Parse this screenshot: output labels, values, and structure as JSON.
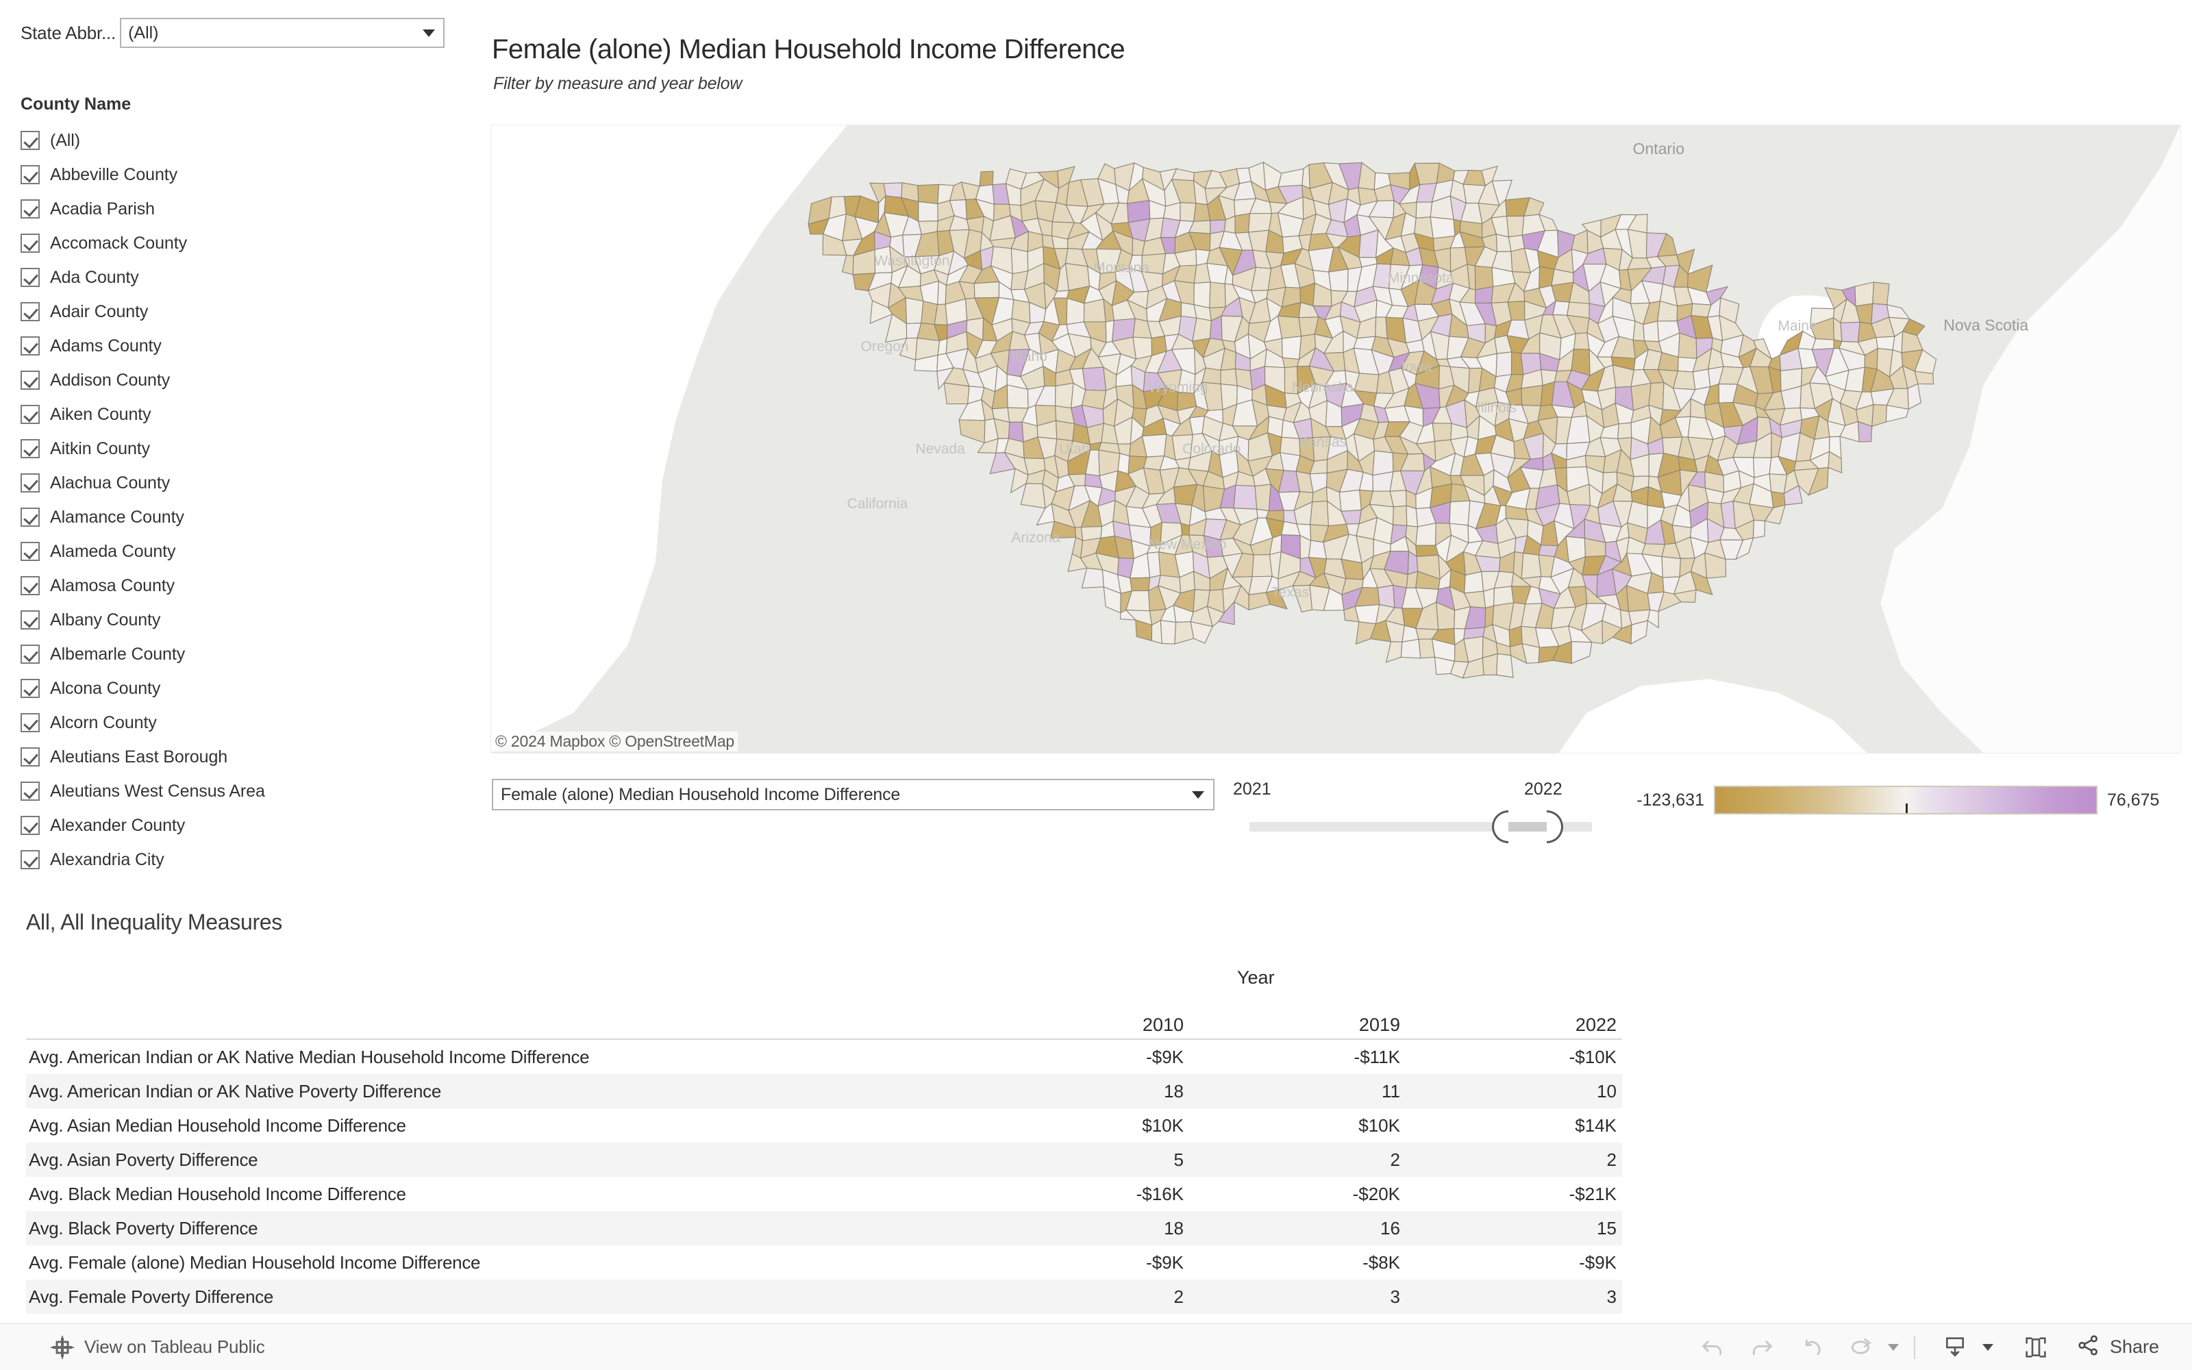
{
  "filters": {
    "state": {
      "label": "State Abbr...",
      "value": "(All)"
    },
    "county": {
      "title": "County Name",
      "items": [
        "(All)",
        "Abbeville County",
        "Acadia Parish",
        "Accomack County",
        "Ada County",
        "Adair County",
        "Adams County",
        "Addison County",
        "Aiken County",
        "Aitkin County",
        "Alachua County",
        "Alamance County",
        "Alameda County",
        "Alamosa County",
        "Albany County",
        "Albemarle County",
        "Alcona County",
        "Alcorn County",
        "Aleutians East Borough",
        "Aleutians West Census Area",
        "Alexander County",
        "Alexandria City"
      ]
    }
  },
  "viz": {
    "title": "Female (alone) Median Household Income Difference",
    "subtitle": "Filter by measure and year below",
    "attribution": "© 2024 Mapbox  © OpenStreetMap",
    "map_labels": [
      "Ontario",
      "Nova Scotia"
    ],
    "map_state_labels": [
      "Washington",
      "Montana",
      "Oregon",
      "Idaho",
      "Wyoming",
      "Nevada",
      "Utah",
      "Colorado",
      "California",
      "Arizona",
      "New Mexico",
      "Texas",
      "Kansas",
      "Nebraska",
      "Iowa",
      "Minnesota",
      "Illinois",
      "Maine"
    ]
  },
  "measure_select": {
    "value": "Female (alone) Median Household Income Difference"
  },
  "year_slider": {
    "min_label": "2021",
    "max_label": "2022"
  },
  "legend": {
    "min": "-123,631",
    "max": "76,675",
    "low_color": "#bf9a47",
    "mid_color": "#f4f2ef",
    "high_color": "#bd8fcd"
  },
  "crosstab": {
    "title": "All, All Inequality Measures",
    "year_group_label": "Year",
    "columns": [
      "2010",
      "2019",
      "2022"
    ],
    "rows": [
      {
        "measure": "Avg. American Indian or AK Native Median Household Income Difference",
        "values": [
          "-$9K",
          "-$11K",
          "-$10K"
        ]
      },
      {
        "measure": "Avg. American Indian or AK Native Poverty Difference",
        "values": [
          "18",
          "11",
          "10"
        ]
      },
      {
        "measure": "Avg. Asian Median Household Income Difference",
        "values": [
          "$10K",
          "$10K",
          "$14K"
        ]
      },
      {
        "measure": "Avg. Asian Poverty Difference",
        "values": [
          "5",
          "2",
          "2"
        ]
      },
      {
        "measure": "Avg. Black Median Household Income Difference",
        "values": [
          "-$16K",
          "-$20K",
          "-$21K"
        ]
      },
      {
        "measure": "Avg. Black Poverty Difference",
        "values": [
          "18",
          "16",
          "15"
        ]
      },
      {
        "measure": "Avg. Female (alone) Median Household Income Difference",
        "values": [
          "-$9K",
          "-$8K",
          "-$9K"
        ]
      },
      {
        "measure": "Avg. Female Poverty Difference",
        "values": [
          "2",
          "3",
          "3"
        ]
      }
    ]
  },
  "toolbar": {
    "view_on_tableau": "View on Tableau Public",
    "share_label": "Share",
    "icons": [
      "undo-icon",
      "redo-icon",
      "revert-icon",
      "refresh-icon",
      "download-icon",
      "fullscreen-icon",
      "share-icon"
    ]
  },
  "chart_data": {
    "type": "table",
    "title": "All, All Inequality Measures",
    "categories": [
      "2010",
      "2019",
      "2022"
    ],
    "series": [
      {
        "name": "Avg. American Indian or AK Native Median Household Income Difference",
        "values": [
          -9000,
          -11000,
          -10000
        ]
      },
      {
        "name": "Avg. American Indian or AK Native Poverty Difference",
        "values": [
          18,
          11,
          10
        ]
      },
      {
        "name": "Avg. Asian Median Household Income Difference",
        "values": [
          10000,
          10000,
          14000
        ]
      },
      {
        "name": "Avg. Asian Poverty Difference",
        "values": [
          5,
          2,
          2
        ]
      },
      {
        "name": "Avg. Black Median Household Income Difference",
        "values": [
          -16000,
          -20000,
          -21000
        ]
      },
      {
        "name": "Avg. Black Poverty Difference",
        "values": [
          18,
          16,
          15
        ]
      },
      {
        "name": "Avg. Female (alone) Median Household Income Difference",
        "values": [
          -9000,
          -8000,
          -9000
        ]
      },
      {
        "name": "Avg. Female Poverty Difference",
        "values": [
          2,
          3,
          3
        ]
      }
    ],
    "xlabel": "Year",
    "ylabel": "",
    "map": {
      "type": "heatmap",
      "description": "US county choropleth of Female (alone) Median Household Income Difference",
      "color_min": -123631,
      "color_max": 76675
    }
  }
}
